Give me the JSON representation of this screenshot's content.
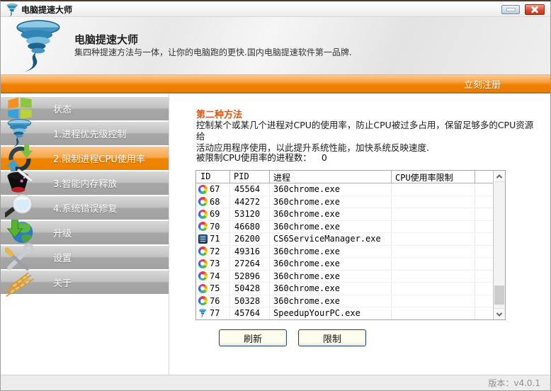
{
  "window": {
    "title": "电脑提速大师"
  },
  "header": {
    "title": "电脑提速大师",
    "subtitle": "集四种提速方法与一体，让你的电脑跑的更快.国内电脑提速软件第一品牌."
  },
  "register_bar": {
    "label": "立刻注册"
  },
  "sidebar": {
    "selected_index": 2,
    "items": [
      {
        "label": "状态",
        "icon": "windows-logo-icon"
      },
      {
        "label": "1.进程优先级控制",
        "icon": "tornado-icon"
      },
      {
        "label": "2.限制进程CPU使用率",
        "icon": "recycle-arrows-icon"
      },
      {
        "label": "3.智能内存释放",
        "icon": "magic-hat-icon"
      },
      {
        "label": "4.系统错误修复",
        "icon": "magnifier-icon"
      },
      {
        "label": "升级",
        "icon": "globe-download-icon"
      },
      {
        "label": "设置",
        "icon": "tools-icon"
      },
      {
        "label": "关于",
        "icon": "wheat-icon"
      }
    ]
  },
  "content": {
    "section_title": "第二种方法",
    "description_line1": "控制某个或某几个进程对CPU的使用率，防止CPU被过多占用，保留足够多的CPU资源给",
    "description_line2": "活动应用程序使用，以此提升系统性能，加快系统反映速度.",
    "limited_label": "被限制CPU使用率的进程数：",
    "limited_value": "0",
    "table": {
      "columns": [
        "ID",
        "PID",
        "进程",
        "CPU使用率限制"
      ],
      "rows": [
        {
          "icon": "chrome-wheel-icon",
          "id": "67",
          "pid": "45564",
          "process": "360chrome.exe",
          "limit": ""
        },
        {
          "icon": "chrome-wheel-icon",
          "id": "68",
          "pid": "44272",
          "process": "360chrome.exe",
          "limit": ""
        },
        {
          "icon": "chrome-wheel-icon",
          "id": "69",
          "pid": "53120",
          "process": "360chrome.exe",
          "limit": ""
        },
        {
          "icon": "chrome-wheel-icon",
          "id": "70",
          "pid": "46680",
          "process": "360chrome.exe",
          "limit": ""
        },
        {
          "icon": "document-stack-icon",
          "id": "71",
          "pid": "26200",
          "process": "CS6ServiceManager.exe",
          "limit": ""
        },
        {
          "icon": "chrome-wheel-icon",
          "id": "72",
          "pid": "49316",
          "process": "360chrome.exe",
          "limit": ""
        },
        {
          "icon": "chrome-wheel-icon",
          "id": "73",
          "pid": "27264",
          "process": "360chrome.exe",
          "limit": ""
        },
        {
          "icon": "chrome-wheel-icon",
          "id": "74",
          "pid": "52896",
          "process": "360chrome.exe",
          "limit": ""
        },
        {
          "icon": "chrome-wheel-icon",
          "id": "75",
          "pid": "50428",
          "process": "360chrome.exe",
          "limit": ""
        },
        {
          "icon": "chrome-wheel-icon",
          "id": "76",
          "pid": "50328",
          "process": "360chrome.exe",
          "limit": ""
        },
        {
          "icon": "tornado-small-icon",
          "id": "77",
          "pid": "45764",
          "process": "SpeedupYourPC.exe",
          "limit": ""
        }
      ]
    },
    "buttons": {
      "refresh": "刷新",
      "limit": "限制"
    }
  },
  "status_bar": {
    "version_label": "版本：v4.0.1"
  },
  "colors": {
    "accent_orange": "#f08200",
    "selected_sidebar": "#ef8500",
    "section_title_red": "#e85206",
    "button_border_navy": "#1b3f77"
  }
}
